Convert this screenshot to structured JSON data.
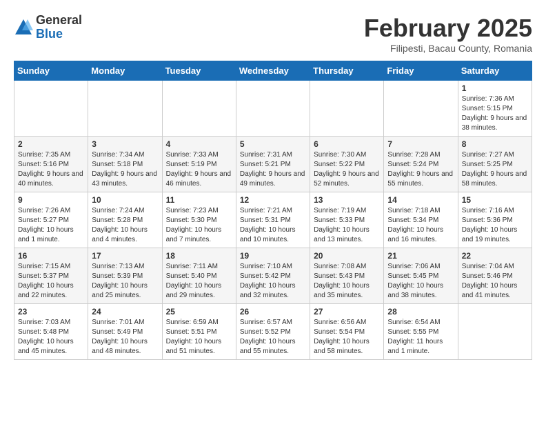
{
  "header": {
    "logo_general": "General",
    "logo_blue": "Blue",
    "month_title": "February 2025",
    "location": "Filipesti, Bacau County, Romania"
  },
  "days_of_week": [
    "Sunday",
    "Monday",
    "Tuesday",
    "Wednesday",
    "Thursday",
    "Friday",
    "Saturday"
  ],
  "weeks": [
    [
      {
        "day": "",
        "info": ""
      },
      {
        "day": "",
        "info": ""
      },
      {
        "day": "",
        "info": ""
      },
      {
        "day": "",
        "info": ""
      },
      {
        "day": "",
        "info": ""
      },
      {
        "day": "",
        "info": ""
      },
      {
        "day": "1",
        "info": "Sunrise: 7:36 AM\nSunset: 5:15 PM\nDaylight: 9 hours and 38 minutes."
      }
    ],
    [
      {
        "day": "2",
        "info": "Sunrise: 7:35 AM\nSunset: 5:16 PM\nDaylight: 9 hours and 40 minutes."
      },
      {
        "day": "3",
        "info": "Sunrise: 7:34 AM\nSunset: 5:18 PM\nDaylight: 9 hours and 43 minutes."
      },
      {
        "day": "4",
        "info": "Sunrise: 7:33 AM\nSunset: 5:19 PM\nDaylight: 9 hours and 46 minutes."
      },
      {
        "day": "5",
        "info": "Sunrise: 7:31 AM\nSunset: 5:21 PM\nDaylight: 9 hours and 49 minutes."
      },
      {
        "day": "6",
        "info": "Sunrise: 7:30 AM\nSunset: 5:22 PM\nDaylight: 9 hours and 52 minutes."
      },
      {
        "day": "7",
        "info": "Sunrise: 7:28 AM\nSunset: 5:24 PM\nDaylight: 9 hours and 55 minutes."
      },
      {
        "day": "8",
        "info": "Sunrise: 7:27 AM\nSunset: 5:25 PM\nDaylight: 9 hours and 58 minutes."
      }
    ],
    [
      {
        "day": "9",
        "info": "Sunrise: 7:26 AM\nSunset: 5:27 PM\nDaylight: 10 hours and 1 minute."
      },
      {
        "day": "10",
        "info": "Sunrise: 7:24 AM\nSunset: 5:28 PM\nDaylight: 10 hours and 4 minutes."
      },
      {
        "day": "11",
        "info": "Sunrise: 7:23 AM\nSunset: 5:30 PM\nDaylight: 10 hours and 7 minutes."
      },
      {
        "day": "12",
        "info": "Sunrise: 7:21 AM\nSunset: 5:31 PM\nDaylight: 10 hours and 10 minutes."
      },
      {
        "day": "13",
        "info": "Sunrise: 7:19 AM\nSunset: 5:33 PM\nDaylight: 10 hours and 13 minutes."
      },
      {
        "day": "14",
        "info": "Sunrise: 7:18 AM\nSunset: 5:34 PM\nDaylight: 10 hours and 16 minutes."
      },
      {
        "day": "15",
        "info": "Sunrise: 7:16 AM\nSunset: 5:36 PM\nDaylight: 10 hours and 19 minutes."
      }
    ],
    [
      {
        "day": "16",
        "info": "Sunrise: 7:15 AM\nSunset: 5:37 PM\nDaylight: 10 hours and 22 minutes."
      },
      {
        "day": "17",
        "info": "Sunrise: 7:13 AM\nSunset: 5:39 PM\nDaylight: 10 hours and 25 minutes."
      },
      {
        "day": "18",
        "info": "Sunrise: 7:11 AM\nSunset: 5:40 PM\nDaylight: 10 hours and 29 minutes."
      },
      {
        "day": "19",
        "info": "Sunrise: 7:10 AM\nSunset: 5:42 PM\nDaylight: 10 hours and 32 minutes."
      },
      {
        "day": "20",
        "info": "Sunrise: 7:08 AM\nSunset: 5:43 PM\nDaylight: 10 hours and 35 minutes."
      },
      {
        "day": "21",
        "info": "Sunrise: 7:06 AM\nSunset: 5:45 PM\nDaylight: 10 hours and 38 minutes."
      },
      {
        "day": "22",
        "info": "Sunrise: 7:04 AM\nSunset: 5:46 PM\nDaylight: 10 hours and 41 minutes."
      }
    ],
    [
      {
        "day": "23",
        "info": "Sunrise: 7:03 AM\nSunset: 5:48 PM\nDaylight: 10 hours and 45 minutes."
      },
      {
        "day": "24",
        "info": "Sunrise: 7:01 AM\nSunset: 5:49 PM\nDaylight: 10 hours and 48 minutes."
      },
      {
        "day": "25",
        "info": "Sunrise: 6:59 AM\nSunset: 5:51 PM\nDaylight: 10 hours and 51 minutes."
      },
      {
        "day": "26",
        "info": "Sunrise: 6:57 AM\nSunset: 5:52 PM\nDaylight: 10 hours and 55 minutes."
      },
      {
        "day": "27",
        "info": "Sunrise: 6:56 AM\nSunset: 5:54 PM\nDaylight: 10 hours and 58 minutes."
      },
      {
        "day": "28",
        "info": "Sunrise: 6:54 AM\nSunset: 5:55 PM\nDaylight: 11 hours and 1 minute."
      },
      {
        "day": "",
        "info": ""
      }
    ]
  ]
}
